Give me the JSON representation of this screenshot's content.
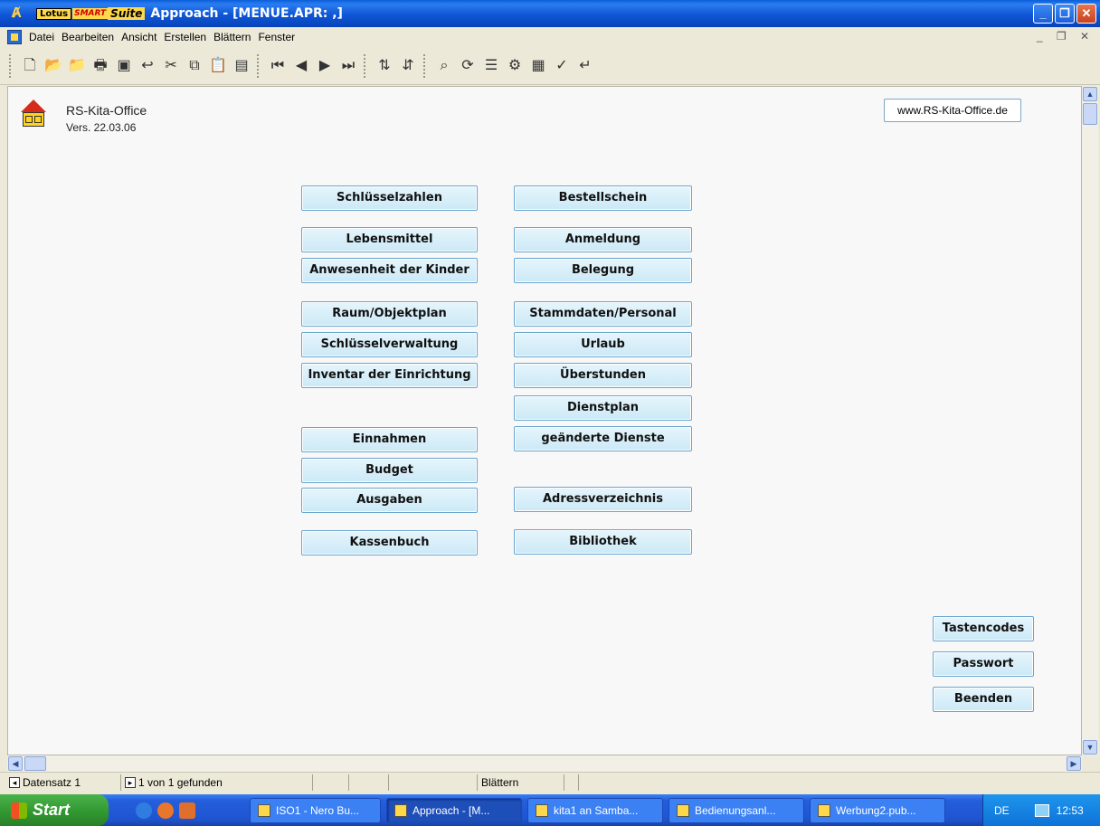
{
  "window": {
    "brand_lotus": "Lotus",
    "brand_smart": "SMART",
    "brand_suite": "Suite",
    "title": "Approach - [MENUE.APR: ,]"
  },
  "menu": [
    "Datei",
    "Bearbeiten",
    "Ansicht",
    "Erstellen",
    "Blättern",
    "Fenster"
  ],
  "app": {
    "name": "RS-Kita-Office",
    "version": "Vers.  22.03.06",
    "website": "www.RS-Kita-Office.de"
  },
  "buttons": {
    "left": {
      "schluesselzahlen": "Schlüsselzahlen",
      "lebensmittel": "Lebensmittel",
      "anwesenheit": "Anwesenheit der Kinder",
      "raumplan": "Raum/Objektplan",
      "schluesselverwaltung": "Schlüsselverwaltung",
      "inventar": "Inventar der Einrichtung",
      "einnahmen": "Einnahmen",
      "budget": "Budget",
      "ausgaben": "Ausgaben",
      "kassenbuch": "Kassenbuch"
    },
    "right": {
      "bestellschein": "Bestellschein",
      "anmeldung": "Anmeldung",
      "belegung": "Belegung",
      "stammdaten": "Stammdaten/Personal",
      "urlaub": "Urlaub",
      "ueberstunden": "Überstunden",
      "dienstplan": "Dienstplan",
      "geaenderte": "geänderte Dienste",
      "adressen": "Adressverzeichnis",
      "bibliothek": "Bibliothek"
    },
    "side": {
      "tastencodes": "Tastencodes",
      "passwort": "Passwort",
      "beenden": "Beenden"
    }
  },
  "status": {
    "record": "Datensatz 1",
    "found": "1 von 1 gefunden",
    "mode": "Blättern"
  },
  "taskbar": {
    "start": "Start",
    "tasks": [
      "ISO1 - Nero Bu...",
      "Approach - [M...",
      "kita1 an Samba...",
      "Bedienungsanl...",
      "Werbung2.pub..."
    ],
    "lang": "DE",
    "clock": "12:53"
  }
}
